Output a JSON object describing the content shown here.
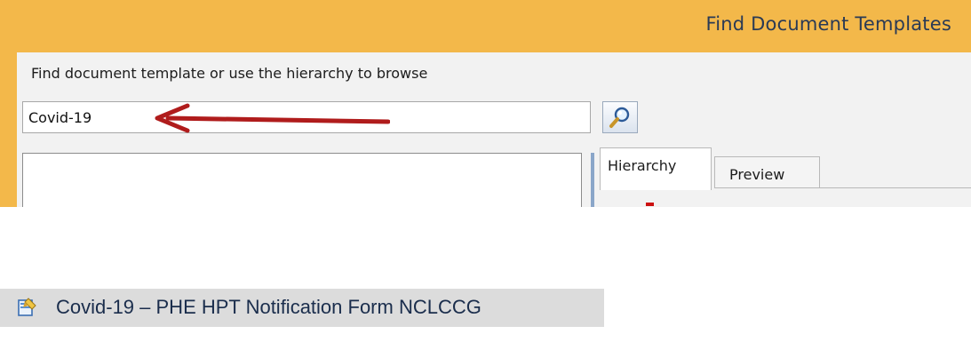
{
  "dialog": {
    "title": "Find Document Templates",
    "instruction": "Find document template or use the hierarchy to browse",
    "search": {
      "value": "Covid-19",
      "button_icon": "magnifier-icon",
      "annotation": "red-arrow-pointing-left"
    },
    "tabs": [
      {
        "label": "Hierarchy",
        "active": true
      },
      {
        "label": "Preview",
        "active": false
      }
    ],
    "tree_marker_icon": "collapse-minus-icon"
  },
  "result": {
    "icon": "document-template-icon",
    "label": "Covid-19 – PHE HPT Notification Form NCLCCG"
  },
  "colors": {
    "window_frame": "#f3b84a",
    "dialog_body": "#f2f2f2",
    "arrow": "#b01c1c",
    "result_background": "#dcdcdc",
    "result_text": "#1a2d4c"
  }
}
